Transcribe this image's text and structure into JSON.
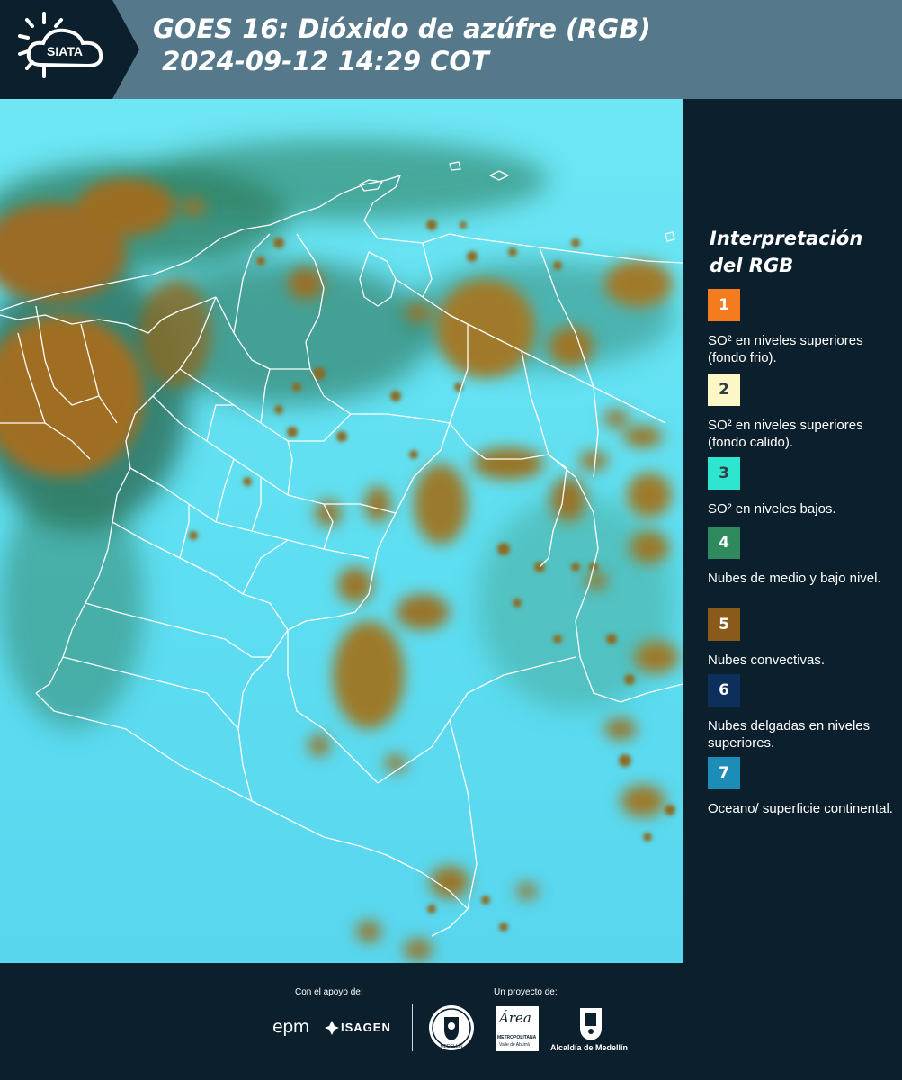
{
  "header": {
    "logo_text": "SIATA",
    "title_line1": "GOES 16: Dióxido de azúfre (RGB)",
    "title_line2": " 2024-09-12 14:29 COT"
  },
  "legend": {
    "title_line1": "Interpretación",
    "title_line2": "del RGB",
    "items": [
      {
        "num": "1",
        "color": "#f47b1e",
        "num_color": "#ffffff",
        "label": "SO² en niveles superiores (fondo frio)."
      },
      {
        "num": "2",
        "color": "#fdf7c8",
        "num_color": "#2f3d44",
        "label": "SO² en niveles superiores (fondo calido)."
      },
      {
        "num": "3",
        "color": "#2ee6cf",
        "num_color": "#2f3d44",
        "label": "SO² en niveles bajos."
      },
      {
        "num": "4",
        "color": "#2f8a5e",
        "num_color": "#ffffff",
        "label": "Nubes de medio y bajo nivel."
      },
      {
        "num": "5",
        "color": "#8a5a1a",
        "num_color": "#ffffff",
        "label": "Nubes convectivas."
      },
      {
        "num": "6",
        "color": "#0d2f5c",
        "num_color": "#ffffff",
        "label": "Nubes delgadas en niveles superiores."
      },
      {
        "num": "7",
        "color": "#1c8db7",
        "num_color": "#ffffff",
        "label": "Oceano/ superficie continental."
      }
    ]
  },
  "footer": {
    "support_label": "Con el apoyo de:",
    "project_label": "Un proyecto de:",
    "sponsor_epm": "epm",
    "sponsor_isagen": "ISAGEN",
    "sponsor_area": "Área",
    "sponsor_area_sub1": "METROPOLITANA",
    "sponsor_area_sub2": "Valle de Aburrá",
    "sponsor_alcaldia": "Alcaldía de Medellín",
    "seal_text": "MEDELLÍN"
  },
  "colors": {
    "header_bg": "#55798a",
    "panel_bg": "#0c1f2c",
    "map_cyan": "#5fe1f0",
    "convective_brown": "#8a6a1e",
    "midlevel_green": "#2f7a5a"
  }
}
